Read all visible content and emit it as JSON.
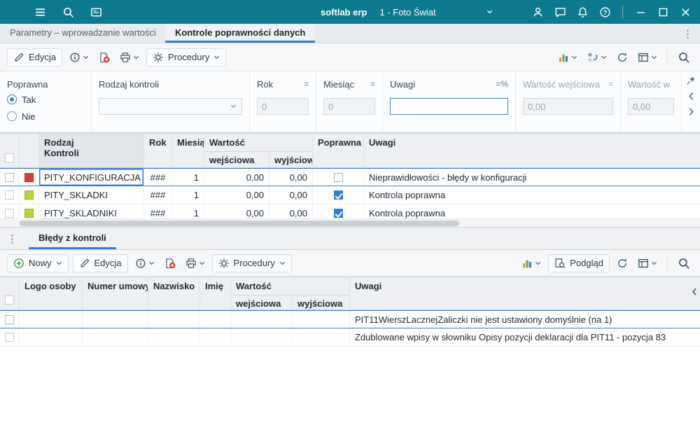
{
  "titlebar": {
    "app_name": "softlab erp",
    "company": "1 - Foto Świat"
  },
  "tabs": {
    "parametry": "Parametry – wprowadzanie wartości",
    "kontrole": "Kontrole poprawności danych"
  },
  "toolbar": {
    "edycja": "Edycja",
    "procedury": "Procedury"
  },
  "filters": {
    "poprawna": {
      "label": "Poprawna",
      "tak": "Tak",
      "nie": "Nie",
      "selected": "Tak"
    },
    "rodzaj": {
      "label": "Rodzaj kontroli",
      "value": ""
    },
    "rok": {
      "label": "Rok",
      "op": "=",
      "value": "0"
    },
    "miesiac": {
      "label": "Miesiąc",
      "op": "=",
      "value": "0"
    },
    "uwagi": {
      "label": "Uwagi",
      "op": "=%",
      "value": ""
    },
    "wartosc_we": {
      "label": "Wartość wejściowa",
      "op": "=",
      "value": "0,00"
    },
    "wartosc_wy": {
      "label": "Wartość w",
      "value": "0,00"
    }
  },
  "main_grid": {
    "headers": {
      "rodzaj1": "Rodzaj",
      "rodzaj2": "Kontroli",
      "rok": "Rok",
      "miesiac": "Miesiąc",
      "wartosc": "Wartość",
      "we": "wejściowa",
      "wy": "wyjściowa",
      "poprawna": "Poprawna",
      "uwagi": "Uwagi"
    },
    "rows": [
      {
        "selected": true,
        "color": "#dd3c3c",
        "rodzaj": "PITY_KONFIGURACJA",
        "rok": "###",
        "miesiac": "1",
        "we": "0,00",
        "wy": "0,00",
        "poprawna": false,
        "uwagi": "Nieprawidłowości - błędy w konfiguracji"
      },
      {
        "selected": false,
        "color": "#bdd136",
        "rodzaj": "PITY_SKLADKI",
        "rok": "###",
        "miesiac": "1",
        "we": "0,00",
        "wy": "0,00",
        "poprawna": true,
        "uwagi": "Kontrola poprawna"
      },
      {
        "selected": false,
        "color": "#bdd136",
        "rodzaj": "PITY_SKLADNIKI",
        "rok": "###",
        "miesiac": "1",
        "we": "0,00",
        "wy": "0,00",
        "poprawna": true,
        "uwagi": "Kontrola poprawna"
      }
    ]
  },
  "bottom": {
    "tab": "Błędy z kontroli",
    "toolbar": {
      "nowy": "Nowy",
      "edycja": "Edycja",
      "procedury": "Procedury",
      "podglad": "Podgląd"
    },
    "grid": {
      "headers": {
        "logo": "Logo osoby",
        "numer": "Numer umowy",
        "nazwisko": "Nazwisko",
        "imie": "Imię",
        "wartosc": "Wartość",
        "we": "wejściowa",
        "wy": "wyjściowa",
        "uwagi": "Uwagi"
      },
      "rows": [
        {
          "selected": true,
          "logo": "",
          "numer": "",
          "nazwisko": "",
          "imie": "",
          "we": "",
          "wy": "",
          "uwagi": "PIT11WierszLacznejZaliczki nie jest ustawiony domyślnie (na 1)"
        },
        {
          "selected": false,
          "logo": "",
          "numer": "",
          "nazwisko": "",
          "imie": "",
          "we": "",
          "wy": "",
          "uwagi": "Zdublowane wpisy w słowniku Opisy pozycji deklaracji dla PIT11 - pozycja 83"
        }
      ]
    }
  },
  "colors": {
    "titlebar": "#0d7b8e",
    "accent": "#2f7fd0",
    "status_error": "#dd3c3c",
    "status_ok": "#bdd136"
  },
  "icons": {
    "menu-icon": "hamburger",
    "search-icon": "magnifier",
    "modules-icon": "window-card",
    "user-icon": "person",
    "chat-icon": "speech-bubble",
    "notifications-icon": "bell",
    "help-icon": "question-circle",
    "minimize-icon": "dash",
    "maximize-icon": "square",
    "close-icon": "x",
    "edit-icon": "pencil",
    "info-icon": "info-circle",
    "delete-icon": "document-red-x",
    "print-icon": "printer",
    "procedures-icon": "gear",
    "chart-icon": "colored-bars",
    "views-icon": "squares-blue-arrow",
    "refresh-icon": "circular-arrows",
    "layout-icon": "table-frame",
    "preview-icon": "document-magnifier",
    "new-icon": "green-plus-circle",
    "pin-icon": "pushpin"
  }
}
